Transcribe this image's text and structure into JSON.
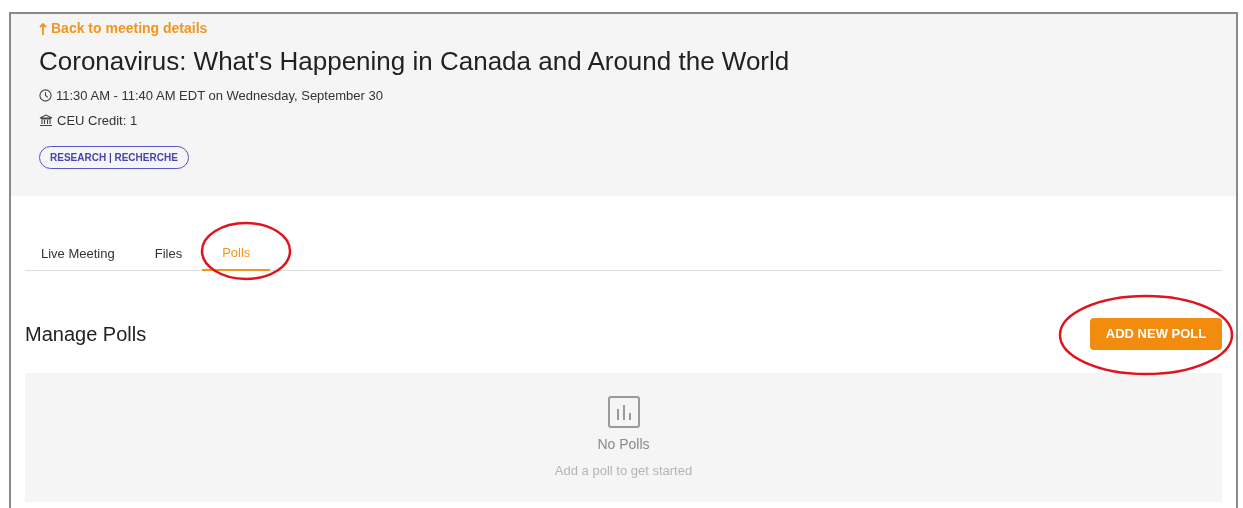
{
  "back_link": "Back to meeting details",
  "title": "Coronavirus: What's Happening in Canada and Around the World",
  "time": "11:30 AM - 11:40 AM EDT on Wednesday, September 30",
  "credit": "CEU Credit: 1",
  "tag": "RESEARCH | RECHERCHE",
  "tabs": [
    {
      "label": "Live Meeting",
      "selected": false
    },
    {
      "label": "Files",
      "selected": false
    },
    {
      "label": "Polls",
      "selected": true
    }
  ],
  "section_title": "Manage Polls",
  "add_button": "ADD NEW POLL",
  "empty_state": {
    "title": "No Polls",
    "message": "Add a poll to get started"
  }
}
